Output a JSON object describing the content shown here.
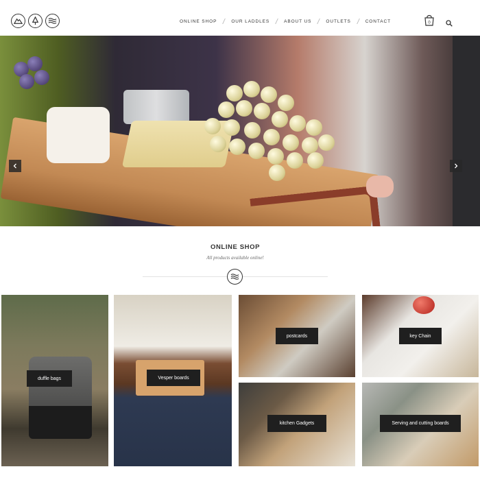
{
  "header": {
    "logo_icons": [
      "mountain-icon",
      "tree-icon",
      "waves-icon"
    ],
    "nav": [
      "ONLINE SHOP",
      "OUR LADDLES",
      "ABOUT US",
      "OUTLETS",
      "CONTACT"
    ],
    "cart_count": "0",
    "cart_icon": "shopping-bag-icon",
    "search_icon": "search-icon"
  },
  "hero": {
    "slides_count": 4,
    "active_slide": 3,
    "prev_icon": "chevron-left-icon",
    "next_icon": "chevron-right-icon"
  },
  "intro": {
    "title": "ONLINE SHOP",
    "subtitle": "All products available online!",
    "divider_icon": "waves-icon"
  },
  "products": [
    {
      "label": "duffle bags"
    },
    {
      "label": "Vesper boards"
    },
    {
      "label": "postcards"
    },
    {
      "label": "key Chain"
    },
    {
      "label": "kitchen Gadgets"
    },
    {
      "label": "Serving and cutting boards"
    }
  ],
  "colors": {
    "text": "#333333",
    "label_bg": "#1f1f1f",
    "label_text": "#ffffff",
    "background": "#ffffff"
  }
}
